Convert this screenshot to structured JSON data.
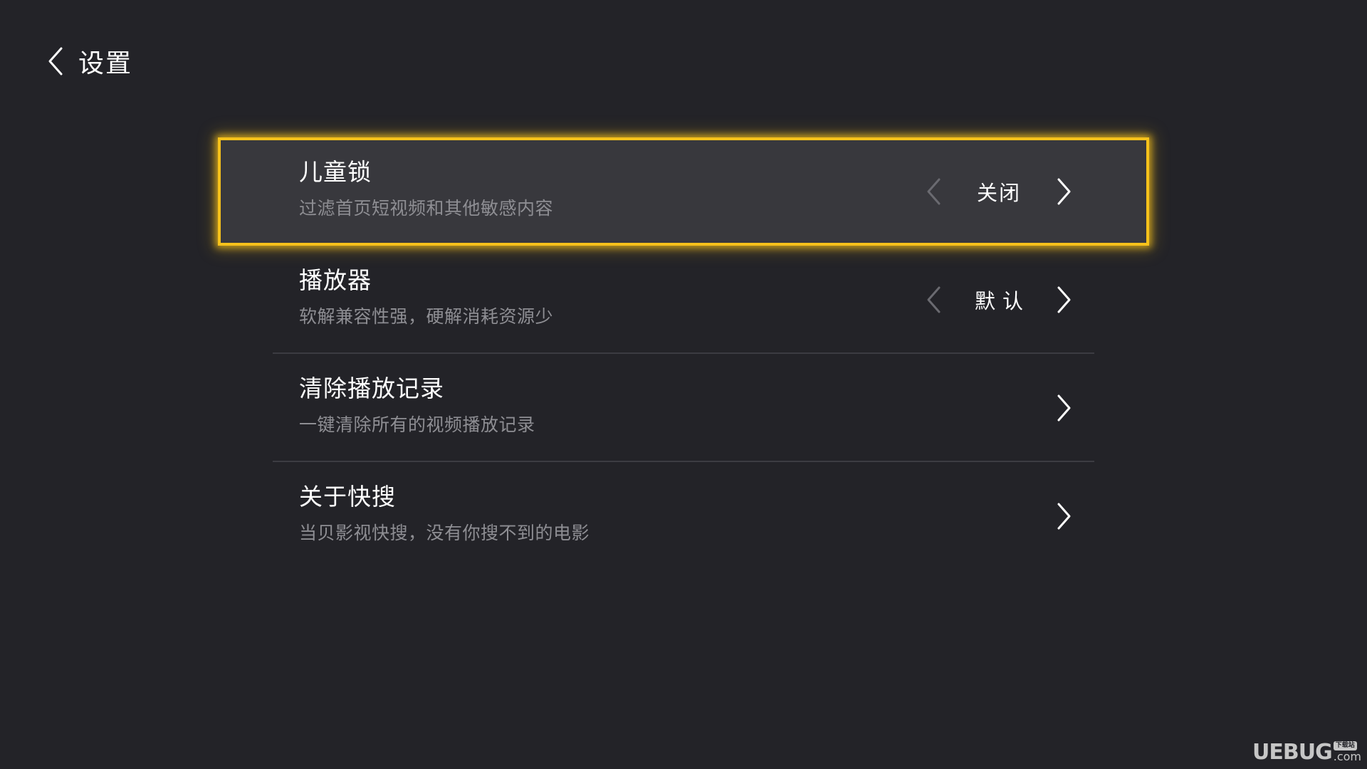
{
  "header": {
    "back_icon": "chevron-left-icon",
    "title": "设置"
  },
  "accent_color": "#f7c21b",
  "settings": [
    {
      "title": "儿童锁",
      "description": "过滤首页短视频和其他敏感内容",
      "value": "关闭",
      "focused": true
    },
    {
      "title": "播放器",
      "description": "软解兼容性强，硬解消耗资源少",
      "value": "默认",
      "focused": false
    },
    {
      "title": "清除播放记录",
      "description": "一键清除所有的视频播放记录",
      "focused": false
    },
    {
      "title": "关于快搜",
      "description": "当贝影视快搜，没有你搜不到的电影",
      "focused": false
    }
  ],
  "watermark": {
    "main": "UEBUG",
    "tag": "下载站",
    "suffix": ".com"
  }
}
